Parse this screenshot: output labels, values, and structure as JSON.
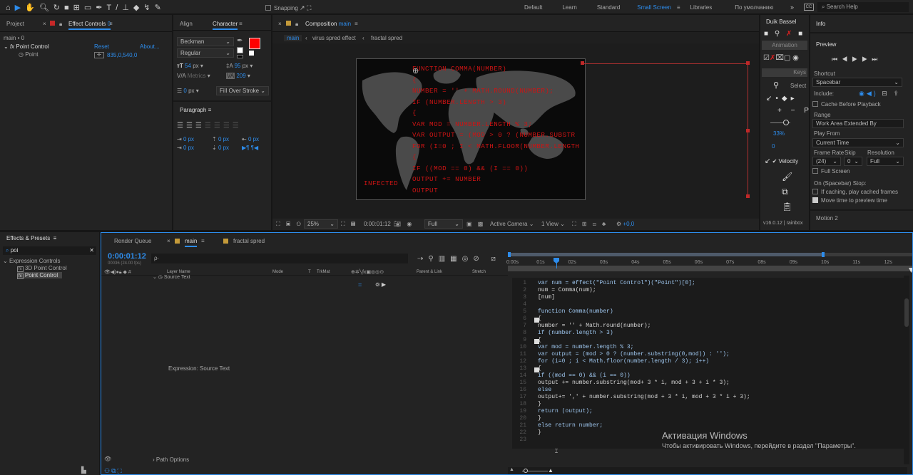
{
  "toolbar": {
    "snapping": "Snapping",
    "workspaces": [
      "Default",
      "Learn",
      "Standard",
      "Small Screen",
      "Libraries",
      "По умолчанию"
    ],
    "active_workspace": "Small Screen",
    "search_placeholder": "Search Help"
  },
  "project_panel": {
    "tab_project": "Project",
    "tab_effect_controls": "Effect Controls",
    "effect_controls_layer": "0",
    "breadcrumb": "main • 0",
    "effect_name": "Point Control",
    "reset": "Reset",
    "about": "About...",
    "param": "Point",
    "param_value": "835,0,540,0"
  },
  "align_tab": "Align",
  "character": {
    "tab": "Character",
    "font": "Beckman",
    "style": "Regular",
    "size": "54",
    "size_unit": "px",
    "leading": "95",
    "leading_unit": "px",
    "tracking_label": "Metrics",
    "tracking": "209",
    "stroke_px": "0",
    "stroke_unit": "px",
    "stroke_mode": "Fill Over Stroke",
    "fill_color": "#ff0000"
  },
  "paragraph": {
    "tab": "Paragraph",
    "v1": "0 px",
    "v2": "0 px",
    "v3": "0 px",
    "v4": "0 px",
    "v5": "0 px"
  },
  "composition": {
    "tab_prefix": "Composition",
    "tab_name": "main",
    "breadcrumbs": [
      "main",
      "virus spred effect",
      "fractal spred"
    ],
    "comp_text": [
      "FUNCTION COMMA(NUMBER)",
      "{",
      "NUMBER = '' + MATH.ROUND(NUMBER);",
      "IF (NUMBER.LENGTH > 3)",
      "{",
      "VAR MOD = NUMBER.LENGTH % 3;",
      "VAR OUTPUT = (MOD > 0 ? (NUMBER.SUBSTR",
      "FOR (I=0 ; I < MATH.FLOOR(NUMBER.LENGTH",
      "{",
      "IF ((MOD == 0) && (I == 0))",
      "OUTPUT += NUMBER",
      "OUTPUT"
    ],
    "infected": "INFECTED",
    "zoom": "25%",
    "timecode": "0:00:01:12",
    "resolution": "Full",
    "camera": "Active Camera",
    "views": "1 View",
    "exposure": "+0,0"
  },
  "duik": {
    "tab": "Duik Bassel",
    "animation": "Animation",
    "keys": "Keys",
    "select": "Select",
    "velocity": "Velocity",
    "zoom": "33%",
    "zero": "0",
    "version": "v16.0.12 | rainbox"
  },
  "info_tab": "Info",
  "preview": {
    "tab": "Preview",
    "shortcut_label": "Shortcut",
    "shortcut": "Spacebar",
    "include": "Include:",
    "cache": "Cache Before Playback",
    "range_label": "Range",
    "range": "Work Area Extended By Current...",
    "play_from_label": "Play From",
    "play_from": "Current Time",
    "frame_rate_label": "Frame Rate",
    "skip_label": "Skip",
    "resolution_label": "Resolution",
    "frame_rate": "(24)",
    "skip": "0",
    "resolution": "Full",
    "full_screen": "Full Screen",
    "stop_label": "On (Spacebar) Stop:",
    "if_caching": "If caching, play cached frames",
    "move_time": "Move time to preview time"
  },
  "motion2": "Motion 2",
  "effects": {
    "tab": "Effects & Presets",
    "search": "poi",
    "category": "Expression Controls",
    "items": [
      "3D Point Control",
      "Point Control"
    ]
  },
  "timeline": {
    "tab_render": "Render Queue",
    "tab_main": "main",
    "tab_fractal": "fractal spred",
    "timecode": "0:00:01:12",
    "frames": "00036 (24.00 fps)",
    "search_placeholder": "ρ·",
    "col_layer": "Layer Name",
    "col_mode": "Mode",
    "col_t": "T",
    "col_trkmat": "TrkMat",
    "col_parent": "Parent & Link",
    "col_stretch": "Stretch",
    "source_text": "Source Text",
    "expr_label": "Expression: Source Text",
    "path_options": "Path Options",
    "ticks": [
      "0:00s",
      "01s",
      "02s",
      "03s",
      "04s",
      "05s",
      "06s",
      "07s",
      "08s",
      "09s",
      "10s",
      "11s",
      "12s"
    ]
  },
  "code": [
    {
      "n": "1",
      "t": "var num = effect(\"Point Control\")(\"Point\")[0];"
    },
    {
      "n": "2",
      "t": "num = Comma(num);"
    },
    {
      "n": "3",
      "t": "[num]"
    },
    {
      "n": "4",
      "t": ""
    },
    {
      "n": "5",
      "t": "function Comma(number)"
    },
    {
      "n": "6",
      "t": "{"
    },
    {
      "n": "7",
      "t": "number = '' + Math.round(number);"
    },
    {
      "n": "8",
      "t": "if (number.length > 3)"
    },
    {
      "n": "9",
      "t": "{"
    },
    {
      "n": "10",
      "t": "var mod = number.length % 3;"
    },
    {
      "n": "11",
      "t": "var output = (mod > 0 ? (number.substring(0,mod)) : '');"
    },
    {
      "n": "12",
      "t": "for (i=0 ; i < Math.floor(number.length / 3); i++)"
    },
    {
      "n": "13",
      "t": "{"
    },
    {
      "n": "14",
      "t": "if ((mod == 0) && (i == 0))"
    },
    {
      "n": "15",
      "t": "output += number.substring(mod+ 3 * i, mod + 3 + i * 3);"
    },
    {
      "n": "16",
      "t": "else"
    },
    {
      "n": "17",
      "t": "output+= ',' + number.substring(mod + 3 * i, mod + 3 * i + 3);"
    },
    {
      "n": "18",
      "t": "}"
    },
    {
      "n": "19",
      "t": "return (output);"
    },
    {
      "n": "20",
      "t": "}"
    },
    {
      "n": "21",
      "t": "else return number;"
    },
    {
      "n": "22",
      "t": "}"
    },
    {
      "n": "23",
      "t": ""
    }
  ],
  "watermark": {
    "title": "Активация Windows",
    "sub": "Чтобы активировать Windows, перейдите в раздел \"Параметры\"."
  }
}
